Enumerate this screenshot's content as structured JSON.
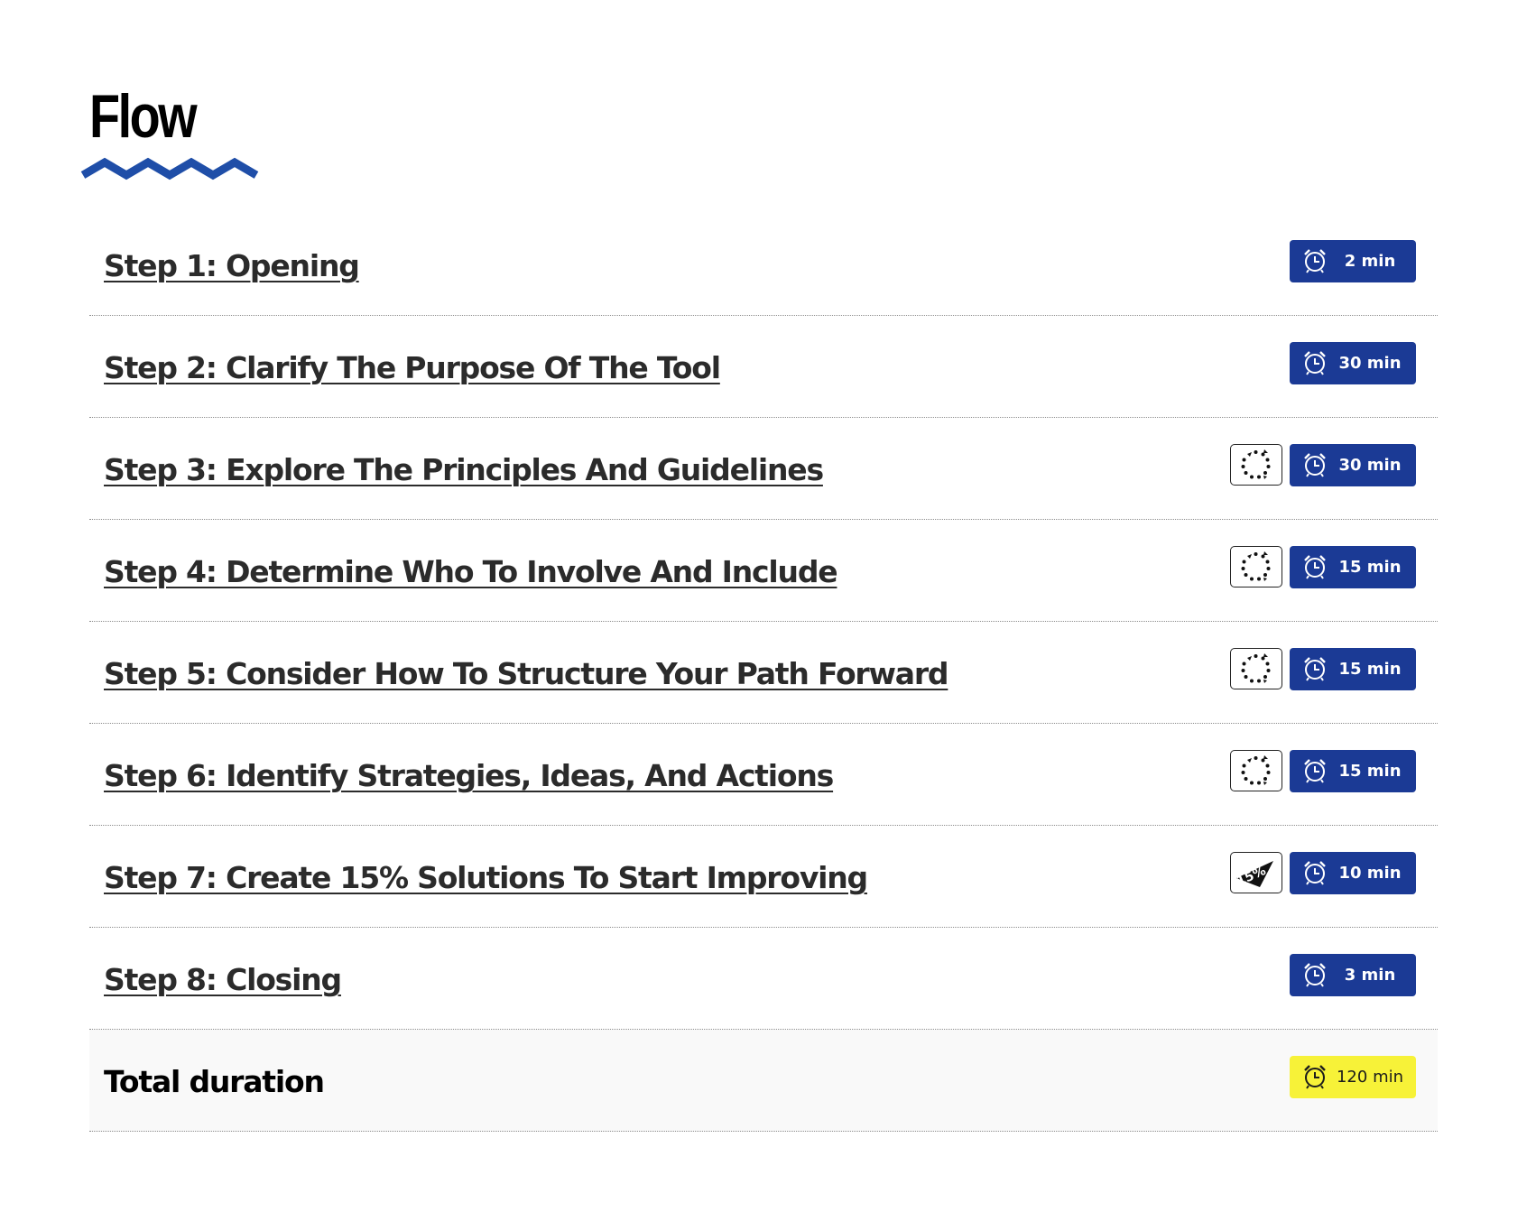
{
  "page": {
    "title": "Flow"
  },
  "colors": {
    "accent": "#1f4ea8",
    "badge": "#1b3a95",
    "total_badge": "#f7f238",
    "link_text": "#2b2b2b"
  },
  "steps": [
    {
      "label": "Step 1: Opening",
      "duration": "2 min",
      "method_icon": ""
    },
    {
      "label": "Step 2: Clarify The Purpose Of The Tool",
      "duration": "30 min",
      "method_icon": ""
    },
    {
      "label": "Step 3: Explore The Principles And Guidelines",
      "duration": "30 min",
      "method_icon": "dotted-circle-icon"
    },
    {
      "label": "Step 4: Determine Who To Involve And Include",
      "duration": "15 min",
      "method_icon": "dotted-circle-icon"
    },
    {
      "label": "Step 5: Consider How To Structure Your Path Forward",
      "duration": "15 min",
      "method_icon": "dotted-circle-icon"
    },
    {
      "label": "Step 6: Identify Strategies, Ideas, And Actions",
      "duration": "15 min",
      "method_icon": "dotted-circle-icon"
    },
    {
      "label": "Step 7: Create 15% Solutions To Start Improving",
      "duration": "10 min",
      "method_icon": "fifteen-percent-icon"
    },
    {
      "label": "Step 8: Closing",
      "duration": "3 min",
      "method_icon": ""
    }
  ],
  "total": {
    "label": "Total duration",
    "duration": "120 min",
    "icon": "alarm-clock-icon"
  },
  "icons": {
    "badge_icon": "alarm-clock-icon",
    "fifteen_percent_text": "15%"
  }
}
